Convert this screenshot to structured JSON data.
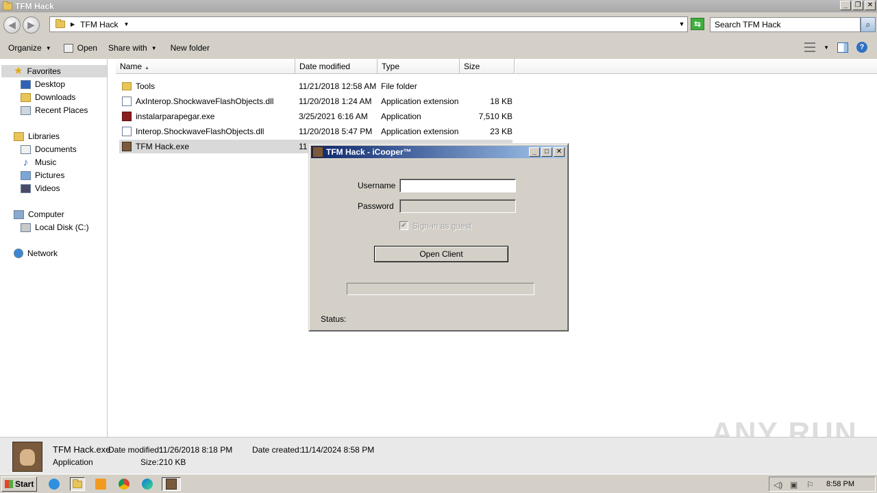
{
  "window": {
    "title": "TFM Hack",
    "btn_min": "_",
    "btn_max": "❐",
    "btn_close": "✕"
  },
  "address": {
    "crumb": "TFM Hack",
    "search_placeholder": "Search TFM Hack"
  },
  "toolbar": {
    "organize": "Organize",
    "open": "Open",
    "share_with": "Share with",
    "new_folder": "New folder"
  },
  "nav": {
    "favorites": "Favorites",
    "desktop": "Desktop",
    "downloads": "Downloads",
    "recent_places": "Recent Places",
    "libraries": "Libraries",
    "documents": "Documents",
    "music": "Music",
    "pictures": "Pictures",
    "videos": "Videos",
    "computer": "Computer",
    "local_disk": "Local Disk (C:)",
    "network": "Network"
  },
  "columns": {
    "name": "Name",
    "date_modified": "Date modified",
    "type": "Type",
    "size": "Size"
  },
  "files": [
    {
      "name": "Tools",
      "date": "11/21/2018 12:58 AM",
      "type": "File folder",
      "size": "",
      "icon": "folder-icon"
    },
    {
      "name": "AxInterop.ShockwaveFlashObjects.dll",
      "date": "11/20/2018 1:24 AM",
      "type": "Application extension",
      "size": "18 KB",
      "icon": "dll-icon"
    },
    {
      "name": "instalarparapegar.exe",
      "date": "3/25/2021 6:16 AM",
      "type": "Application",
      "size": "7,510 KB",
      "icon": "exe-icon"
    },
    {
      "name": "Interop.ShockwaveFlashObjects.dll",
      "date": "11/20/2018 5:47 PM",
      "type": "Application extension",
      "size": "23 KB",
      "icon": "dll-icon"
    },
    {
      "name": "TFM Hack.exe",
      "date": "11",
      "type": "",
      "size": "",
      "icon": "tfm-icon"
    }
  ],
  "details": {
    "filename": "TFM Hack.exe",
    "date_modified_label": "Date modified:",
    "date_modified": "11/26/2018 8:18 PM",
    "date_created_label": "Date created:",
    "date_created": "11/14/2024 8:58 PM",
    "type": "Application",
    "size_label": "Size:",
    "size": "210 KB"
  },
  "watermark": "ANY RUN",
  "taskbar": {
    "start": "Start",
    "clock": "8:58 PM"
  },
  "dialog": {
    "title": "TFM Hack - iCooper™",
    "username_label": "Username",
    "password_label": "Password",
    "guest_label": "Sign-in as guest",
    "guest_checked": true,
    "open_button": "Open Client",
    "status_label": "Status:"
  }
}
